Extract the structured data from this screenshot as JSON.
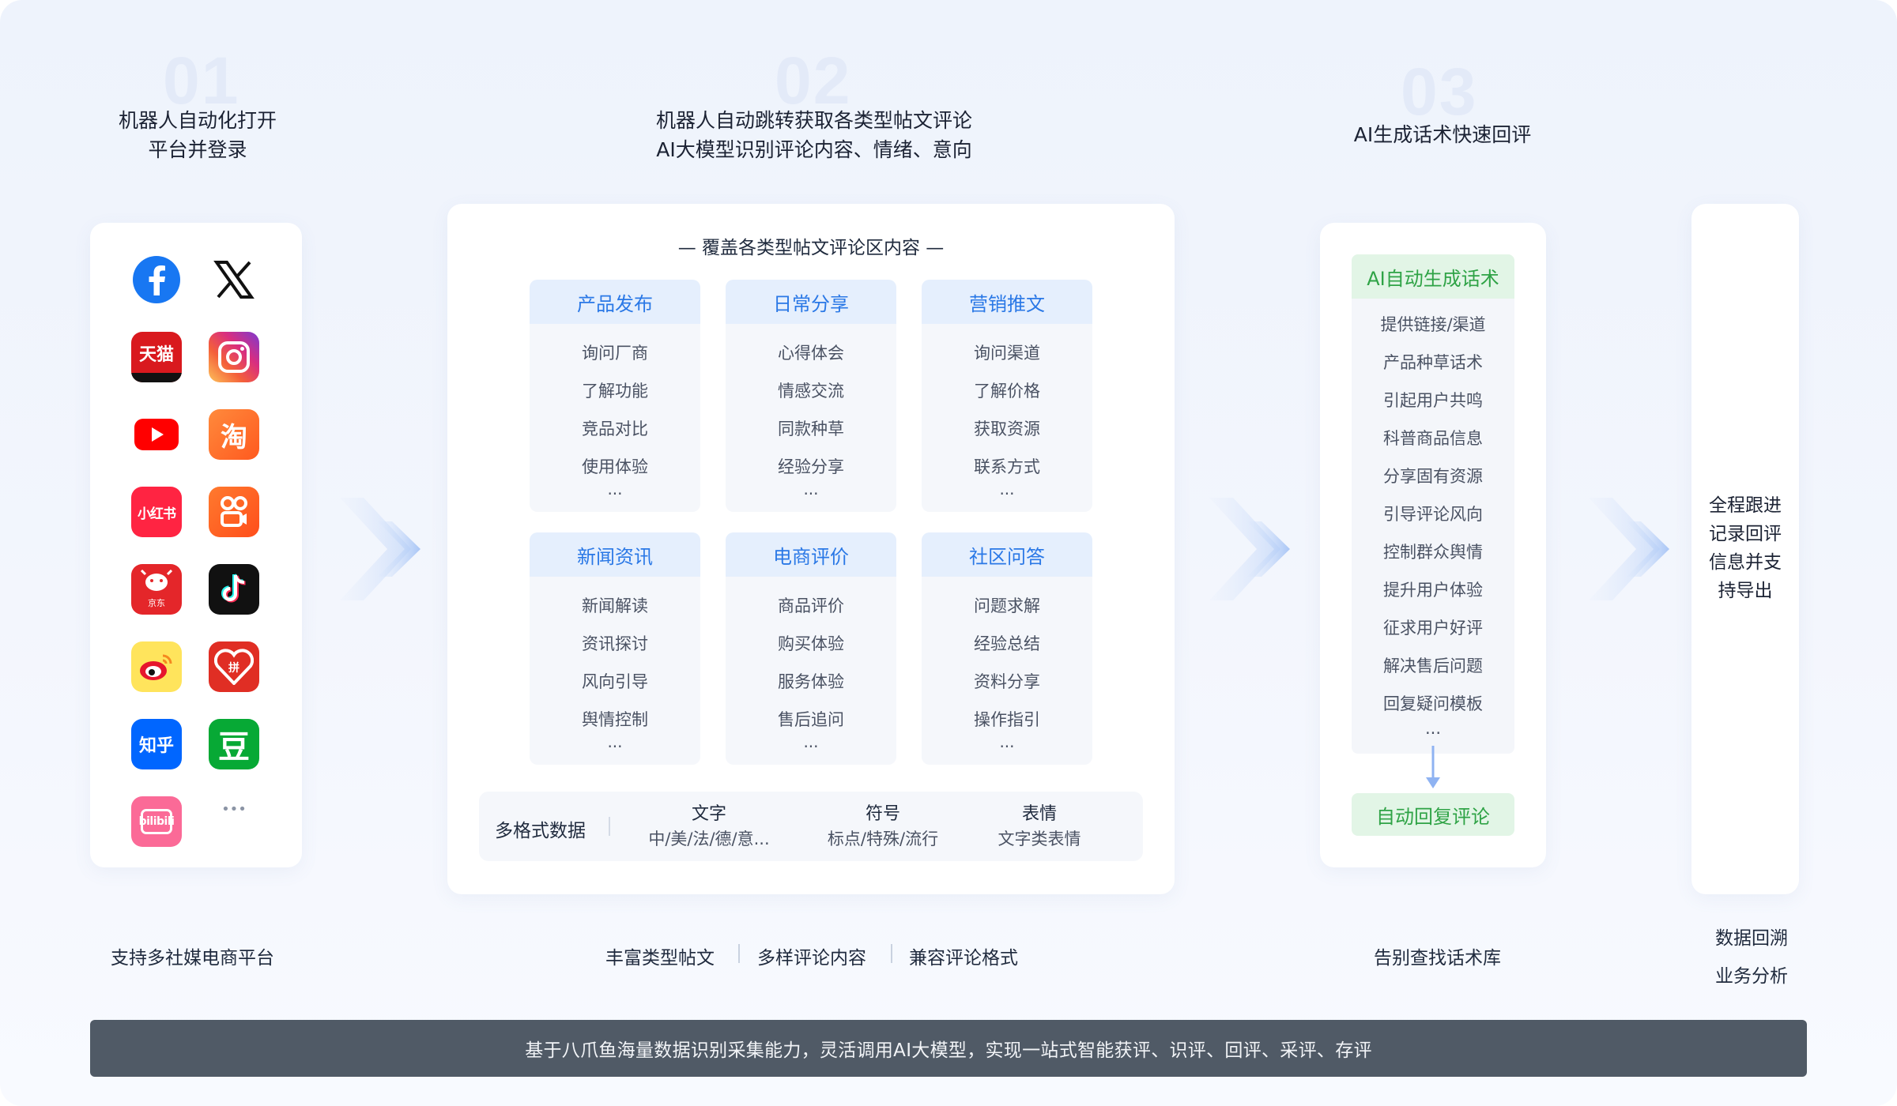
{
  "steps": [
    {
      "num": "01",
      "title_line1": "机器人自动化打开",
      "title_line2": "平台并登录"
    },
    {
      "num": "02",
      "title_line1": "机器人自动跳转获取各类型帖文评论",
      "title_line2": "AI大模型识别评论内容、情绪、意向"
    },
    {
      "num": "03",
      "title_line1": "AI生成话术快速回评"
    }
  ],
  "platforms": [
    {
      "name": "facebook-icon",
      "glyph": "f"
    },
    {
      "name": "x-icon",
      "glyph": "𝕏"
    },
    {
      "name": "tmall-icon",
      "glyph": "天猫"
    },
    {
      "name": "instagram-icon",
      "glyph": ""
    },
    {
      "name": "youtube-icon",
      "glyph": "▶"
    },
    {
      "name": "taobao-icon",
      "glyph": "淘"
    },
    {
      "name": "xiaohongshu-icon",
      "glyph": "小红书"
    },
    {
      "name": "kuaishou-icon",
      "glyph": "⚇"
    },
    {
      "name": "jd-icon",
      "glyph": "京东"
    },
    {
      "name": "tiktok-icon",
      "glyph": "♪"
    },
    {
      "name": "weibo-icon",
      "glyph": "◉"
    },
    {
      "name": "pinduoduo-icon",
      "glyph": "拼"
    },
    {
      "name": "zhihu-icon",
      "glyph": "知乎"
    },
    {
      "name": "douban-icon",
      "glyph": "豆"
    },
    {
      "name": "bilibili-icon",
      "glyph": "bilibili"
    },
    {
      "name": "more-icon",
      "glyph": "•••"
    }
  ],
  "coverage_title": "— 覆盖各类型帖文评论区内容 —",
  "categories": [
    {
      "title": "产品发布",
      "items": [
        "询问厂商",
        "了解功能",
        "竞品对比",
        "使用体验"
      ],
      "more": "..."
    },
    {
      "title": "日常分享",
      "items": [
        "心得体会",
        "情感交流",
        "同款种草",
        "经验分享"
      ],
      "more": "..."
    },
    {
      "title": "营销推文",
      "items": [
        "询问渠道",
        "了解价格",
        "获取资源",
        "联系方式"
      ],
      "more": "..."
    },
    {
      "title": "新闻资讯",
      "items": [
        "新闻解读",
        "资讯探讨",
        "风向引导",
        "舆情控制"
      ],
      "more": "..."
    },
    {
      "title": "电商评价",
      "items": [
        "商品评价",
        "购买体验",
        "服务体验",
        "售后追问"
      ],
      "more": "..."
    },
    {
      "title": "社区问答",
      "items": [
        "问题求解",
        "经验总结",
        "资料分享",
        "操作指引"
      ],
      "more": "..."
    }
  ],
  "multi_format": {
    "label": "多格式数据",
    "columns": [
      {
        "title": "文字",
        "sub": "中/美/法/德/意..."
      },
      {
        "title": "符号",
        "sub": "标点/特殊/流行"
      },
      {
        "title": "表情",
        "sub": "文字类表情"
      }
    ]
  },
  "ai_panel": {
    "header": "AI自动生成话术",
    "items": [
      "提供链接/渠道",
      "产品种草话术",
      "引起用户共鸣",
      "科普商品信息",
      "分享固有资源",
      "引导评论风向",
      "控制群众舆情",
      "提升用户体验",
      "征求用户好评",
      "解决售后问题",
      "回复疑问模板"
    ],
    "more": "...",
    "auto_reply": "自动回复评论"
  },
  "tracking": {
    "lines": [
      "全程跟进",
      "记录回评",
      "信息并支",
      "持导出"
    ]
  },
  "captions": {
    "platforms": "支持多社媒电商平台",
    "content": [
      "丰富类型帖文",
      "多样评论内容",
      "兼容评论格式"
    ],
    "ai": "告别查找话术库",
    "data_line1": "数据回溯",
    "data_line2": "业务分析"
  },
  "footer": "基于八爪鱼海量数据识别采集能力，灵活调用AI大模型，实现一站式智能获评、识评、回评、采评、存评",
  "colors": {
    "accent_blue": "#2a78e6",
    "accent_green": "#2fa346",
    "footer_bg": "#505a66"
  }
}
